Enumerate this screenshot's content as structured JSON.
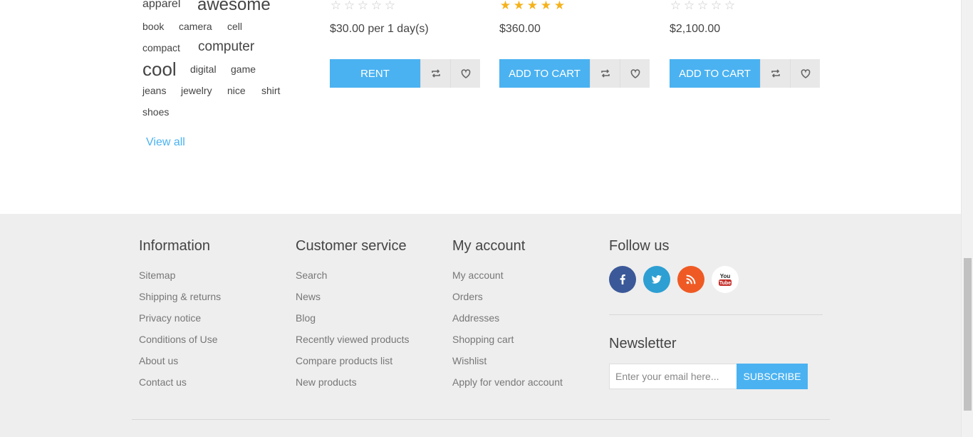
{
  "tags": {
    "items": [
      {
        "label": "apparel"
      },
      {
        "label": "awesome"
      },
      {
        "label": "book"
      },
      {
        "label": "camera"
      },
      {
        "label": "cell"
      },
      {
        "label": "compact"
      },
      {
        "label": "computer"
      },
      {
        "label": "cool"
      },
      {
        "label": "digital"
      },
      {
        "label": "game"
      },
      {
        "label": "jeans"
      },
      {
        "label": "jewelry"
      },
      {
        "label": "nice"
      },
      {
        "label": "shirt"
      },
      {
        "label": "shoes"
      }
    ],
    "view_all": "View all"
  },
  "products": [
    {
      "rating": 0,
      "rating_max": 5,
      "price": "$30.00 per 1 day(s)",
      "button": "RENT"
    },
    {
      "rating": 5,
      "rating_max": 5,
      "price": "$360.00",
      "button": "ADD TO CART"
    },
    {
      "rating": 0,
      "rating_max": 5,
      "price": "$2,100.00",
      "button": "ADD TO CART"
    }
  ],
  "footer": {
    "information": {
      "title": "Information",
      "links": [
        "Sitemap",
        "Shipping & returns",
        "Privacy notice",
        "Conditions of Use",
        "About us",
        "Contact us"
      ]
    },
    "customer_service": {
      "title": "Customer service",
      "links": [
        "Search",
        "News",
        "Blog",
        "Recently viewed products",
        "Compare products list",
        "New products"
      ]
    },
    "my_account": {
      "title": "My account",
      "links": [
        "My account",
        "Orders",
        "Addresses",
        "Shopping cart",
        "Wishlist",
        "Apply for vendor account"
      ]
    },
    "follow": {
      "title": "Follow us",
      "icons": [
        "facebook-icon",
        "twitter-icon",
        "rss-icon",
        "youtube-icon"
      ]
    },
    "newsletter": {
      "title": "Newsletter",
      "placeholder": "Enter your email here...",
      "button": "SUBSCRIBE"
    }
  },
  "colors": {
    "accent": "#4ab2f1",
    "star": "#f5b21c",
    "footer_bg": "#eeeeee",
    "facebook": "#3b5998",
    "twitter": "#2d9fd2",
    "rss": "#ef5a24",
    "youtube": "#ffffff"
  }
}
